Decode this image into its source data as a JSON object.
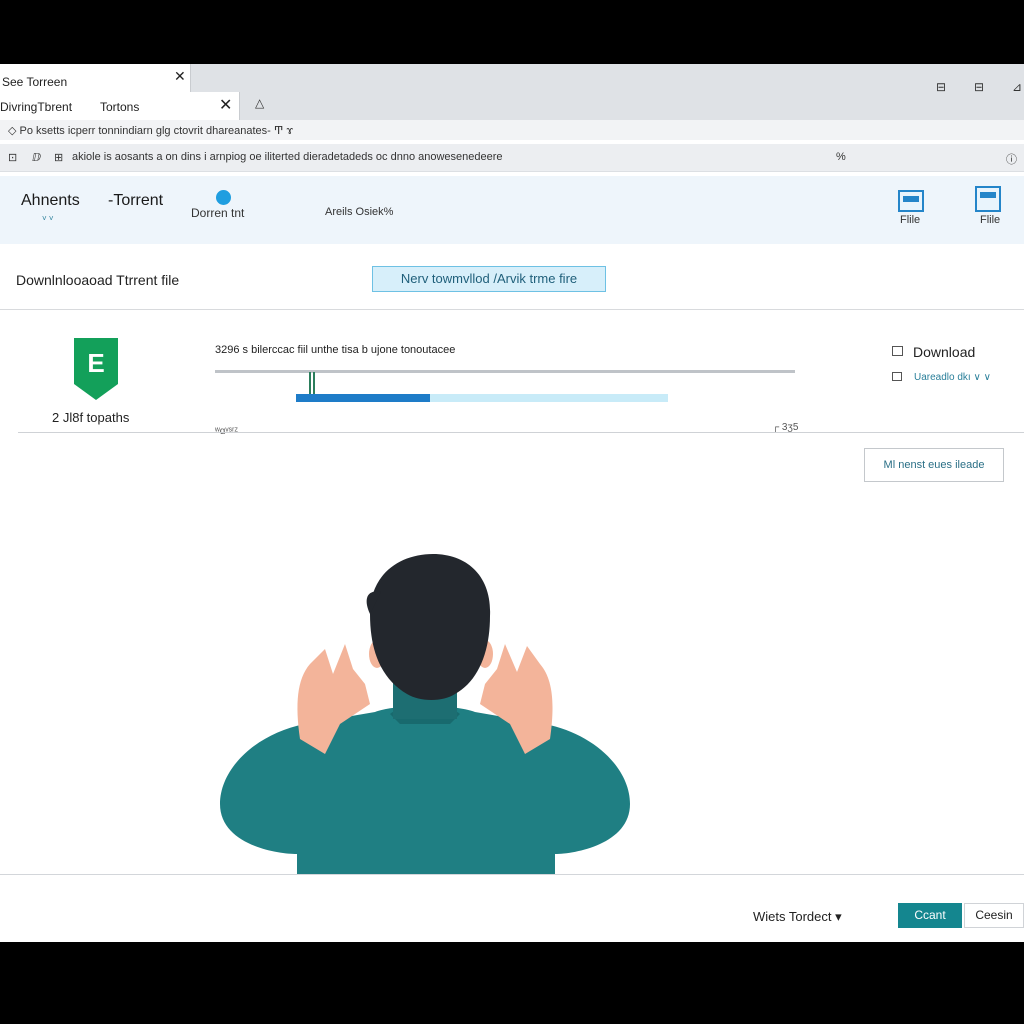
{
  "tabs": [
    {
      "label": "See Torreen",
      "close": "✕"
    },
    {
      "label": "DivringTbrent",
      "label2": "Tortons",
      "close": "✕"
    }
  ],
  "new_tab_icon": "△",
  "window_controls": [
    "⊟",
    "⊟",
    "⊿"
  ],
  "info_bar": {
    "text": "◇ Po ksetts icperr tonnindiarn ɡlg ctovrit dhareanates- Ͳ ɤ"
  },
  "address_bar": {
    "icons": [
      "⊡",
      "ⅅ",
      "⊞"
    ],
    "url": "akiole is aosants a on dins i arnpiog oe iliterted dieradetadeds oc dnno anowesenedeere",
    "right_icon": "%",
    "info_icon": "ⓘ"
  },
  "app_header": {
    "brand": "Ahnents",
    "brand_caret": "˅ ˅",
    "torrent_label": "-Torrent",
    "status_label": "Dorren tnt",
    "info_text": "Areils Osiek%",
    "buttons": [
      {
        "label": "Flile"
      },
      {
        "label": "Flile"
      }
    ]
  },
  "download": {
    "title": "Downlnlooaoad Ttrrent file",
    "new_button": "Nerv towmvllod /Arvik trme fire"
  },
  "torrent": {
    "count_label": "2 Jl8f topaths",
    "shield_letter": "E",
    "description": "3296 s bilerccac fiil unthe tisa b ujone tonoutacee",
    "progress": 0.36,
    "small_left": "ʷɑᵛˢʳᶻ",
    "small_right": "┌ 3ʒ5",
    "download_label": "Download",
    "download_link": "Uareadlo dkı ∨ ∨",
    "secondary_button": "Ml nenst eues ileade"
  },
  "footer": {
    "select_label": "Wiets Tordect ▾",
    "ok_label": "Ccant",
    "cancel_label": "Ceesin"
  },
  "colors": {
    "accent": "#14868f",
    "progress_fill": "#1e7cc8",
    "progress_track": "#c8ebf8",
    "shield": "#13a05a",
    "shirt": "#1f7f83",
    "skin": "#f3b49a",
    "hair": "#23272d"
  }
}
